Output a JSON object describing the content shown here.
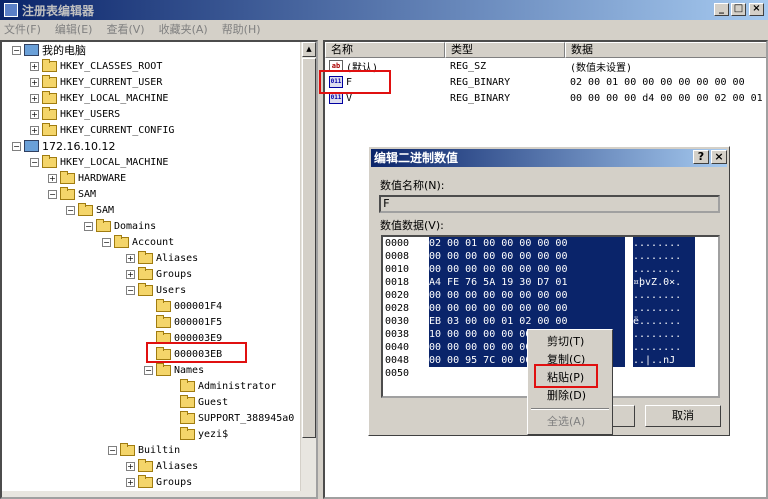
{
  "window": {
    "title": "注册表编辑器"
  },
  "menu": [
    "文件(F)",
    "编辑(E)",
    "查看(V)",
    "收藏夹(A)",
    "帮助(H)"
  ],
  "tree": {
    "my_computer": "我的电脑",
    "hkcr": "HKEY_CLASSES_ROOT",
    "hkcu": "HKEY_CURRENT_USER",
    "hklm": "HKEY_LOCAL_MACHINE",
    "hku": "HKEY_USERS",
    "hkcc": "HKEY_CURRENT_CONFIG",
    "remote": "172.16.10.12",
    "r_hklm": "HKEY_LOCAL_MACHINE",
    "hardware": "HARDWARE",
    "sam1": "SAM",
    "sam2": "SAM",
    "domains": "Domains",
    "account": "Account",
    "aliases": "Aliases",
    "groups": "Groups",
    "users": "Users",
    "u1": "000001F4",
    "u2": "000001F5",
    "u3": "000003E9",
    "u4": "000003EB",
    "names": "Names",
    "n1": "Administrator",
    "n2": "Guest",
    "n3": "SUPPORT_388945a0",
    "n4": "yezi$",
    "builtin": "Builtin",
    "b_aliases": "Aliases",
    "b_groups": "Groups"
  },
  "list": {
    "headers": [
      "名称",
      "类型",
      "数据"
    ],
    "rows": [
      {
        "name": "(默认)",
        "type": "REG_SZ",
        "data": "(数值未设置)"
      },
      {
        "name": "F",
        "type": "REG_BINARY",
        "data": "02 00 01 00 00 00 00 00 00 00"
      },
      {
        "name": "V",
        "type": "REG_BINARY",
        "data": "00 00 00 00 d4 00 00 00 02 00 01"
      }
    ]
  },
  "dialog": {
    "title": "编辑二进制数值",
    "help_btn": "?",
    "close_btn": "×",
    "name_label": "数值名称(N):",
    "name_value": "F",
    "data_label": "数值数据(V):",
    "hex": [
      {
        "off": "0000",
        "bytes": "02 00 01 00 00 00 00 00",
        "ascii": "........"
      },
      {
        "off": "0008",
        "bytes": "00 00 00 00 00 00 00 00",
        "ascii": "........"
      },
      {
        "off": "0010",
        "bytes": "00 00 00 00 00 00 00 00",
        "ascii": "........"
      },
      {
        "off": "0018",
        "bytes": "A4 FE 76 5A 19 30 D7 01",
        "ascii": "¤þvZ.0×."
      },
      {
        "off": "0020",
        "bytes": "00 00 00 00 00 00 00 00",
        "ascii": "........"
      },
      {
        "off": "0028",
        "bytes": "00 00 00 00 00 00 00 00",
        "ascii": "........"
      },
      {
        "off": "0030",
        "bytes": "EB 03 00 00 01 02 00 00",
        "ascii": "ë......."
      },
      {
        "off": "0038",
        "bytes": "10 00 00 00 00 00 00 00",
        "ascii": "........"
      },
      {
        "off": "0040",
        "bytes": "00 00 00 00 00 00 00 00",
        "ascii": "........"
      },
      {
        "off": "0048",
        "bytes": "00 00 95 7C 00 00 00 00",
        "ascii": "..|..nJ"
      },
      {
        "off": "0050",
        "bytes": "",
        "ascii": ""
      }
    ],
    "ok": "确定",
    "cancel": "取消"
  },
  "context_menu": {
    "cut": "剪切(T)",
    "copy": "复制(C)",
    "paste": "粘贴(P)",
    "delete": "删除(D)",
    "select_all": "全选(A)"
  }
}
